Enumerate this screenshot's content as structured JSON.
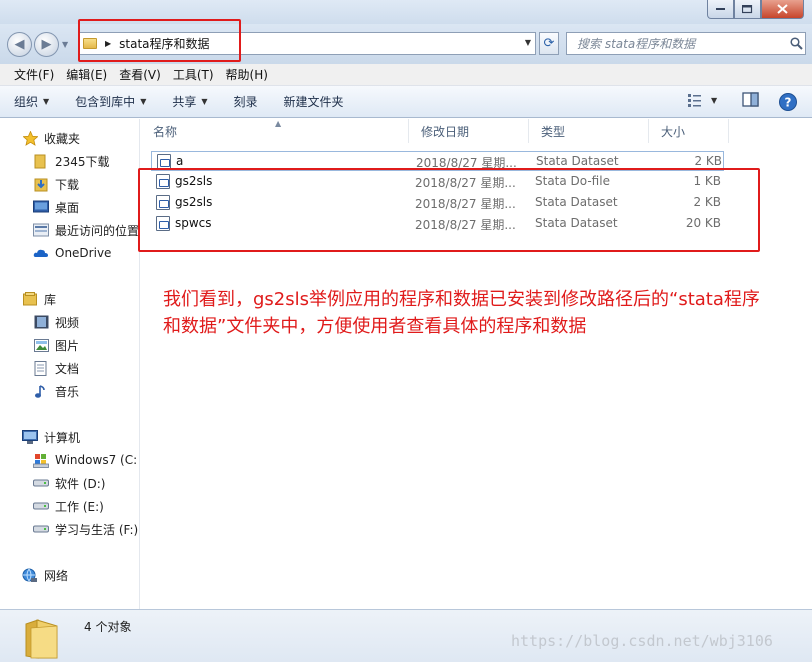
{
  "window": {
    "caption_buttons": [
      "minimize",
      "maximize",
      "close"
    ]
  },
  "address": {
    "path": "stata程序和数据",
    "search_placeholder": "搜索 stata程序和数据"
  },
  "menubar": {
    "items": [
      "文件(F)",
      "编辑(E)",
      "查看(V)",
      "工具(T)",
      "帮助(H)"
    ]
  },
  "toolbar": {
    "items": [
      {
        "label": "组织",
        "dropdown": true
      },
      {
        "label": "包含到库中",
        "dropdown": true
      },
      {
        "label": "共享",
        "dropdown": true
      },
      {
        "label": "刻录",
        "dropdown": false
      },
      {
        "label": "新建文件夹",
        "dropdown": false
      }
    ]
  },
  "sidebar": {
    "favorites_header": "收藏夹",
    "favorites": [
      "2345下载",
      "下载",
      "桌面",
      "最近访问的位置",
      "OneDrive"
    ],
    "library_header": "库",
    "libraries": [
      "视频",
      "图片",
      "文档",
      "音乐"
    ],
    "computer_header": "计算机",
    "drives": [
      "Windows7 (C:",
      "软件 (D:)",
      "工作 (E:)",
      "学习与生活 (F:)"
    ],
    "network_header": "网络"
  },
  "columns": {
    "name": "名称",
    "date": "修改日期",
    "type": "类型",
    "size": "大小"
  },
  "files": [
    {
      "name": "a",
      "date": "2018/8/27 星期...",
      "type": "Stata Dataset",
      "size": "2 KB"
    },
    {
      "name": "gs2sls",
      "date": "2018/8/27 星期...",
      "type": "Stata Do-file",
      "size": "1 KB"
    },
    {
      "name": "gs2sls",
      "date": "2018/8/27 星期...",
      "type": "Stata Dataset",
      "size": "2 KB"
    },
    {
      "name": "spwcs",
      "date": "2018/8/27 星期...",
      "type": "Stata Dataset",
      "size": "20 KB"
    }
  ],
  "annotation": "我们看到，gs2sls举例应用的程序和数据已安装到修改路径后的“stata程序和数据”文件夹中，方便使用者查看具体的程序和数据",
  "status": {
    "count": "4 个对象"
  },
  "watermark": "https://blog.csdn.net/wbj3106",
  "colors": {
    "highlight_red": "#e01b1b",
    "folder_yellow": "#e8c14f",
    "toolbar_bg": "#dfe9f5"
  }
}
